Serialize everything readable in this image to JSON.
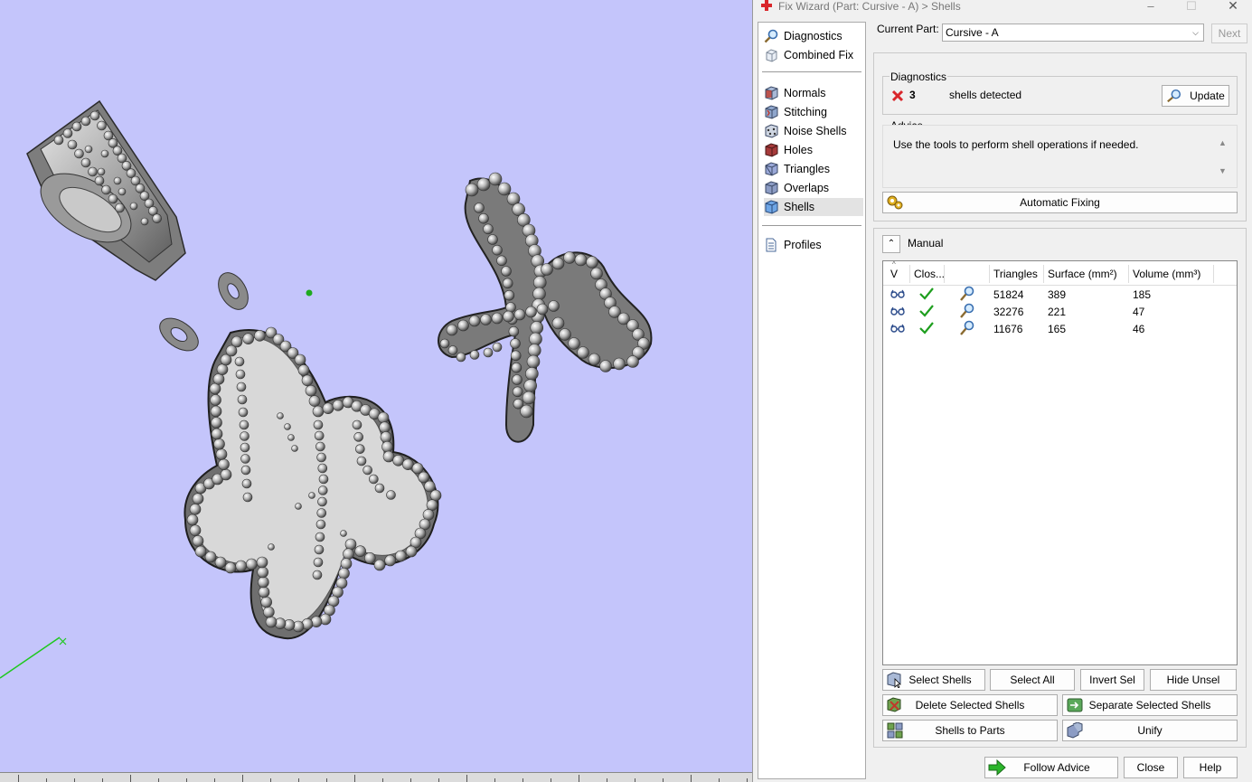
{
  "window": {
    "title": "Fix Wizard (Part: Cursive - A) > Shells",
    "minimize": "–",
    "maximize": "☐",
    "close": "✕"
  },
  "nav": {
    "top_items": [
      {
        "label": "Diagnostics",
        "icon": "magnifier-icon"
      },
      {
        "label": "Combined Fix",
        "icon": "cube-icon"
      }
    ],
    "items": [
      {
        "label": "Normals",
        "icon": "normals-cube-icon"
      },
      {
        "label": "Stitching",
        "icon": "stitching-cube-icon"
      },
      {
        "label": "Noise Shells",
        "icon": "noise-shells-icon"
      },
      {
        "label": "Holes",
        "icon": "holes-cube-icon"
      },
      {
        "label": "Triangles",
        "icon": "triangles-cube-icon"
      },
      {
        "label": "Overlaps",
        "icon": "overlaps-cube-icon"
      },
      {
        "label": "Shells",
        "icon": "shells-cube-icon",
        "selected": true
      }
    ],
    "bottom_items": [
      {
        "label": "Profiles",
        "icon": "document-icon"
      }
    ]
  },
  "current_part": {
    "label": "Current Part:",
    "value": "Cursive - A",
    "next": "Next"
  },
  "diagnostics": {
    "title": "Diagnostics",
    "count": "3",
    "text": "shells detected",
    "update": "Update"
  },
  "advice": {
    "title": "Advice",
    "text": "Use the tools to perform shell operations if needed.",
    "auto_fix": "Automatic Fixing"
  },
  "manual": {
    "title": "Manual",
    "columns": [
      "V",
      "Clos...",
      "",
      "Triangles",
      "Surface (mm²)",
      "Volume (mm³)"
    ],
    "rows": [
      {
        "triangles": "51824",
        "surface": "389",
        "volume": "185"
      },
      {
        "triangles": "32276",
        "surface": "221",
        "volume": "47"
      },
      {
        "triangles": "11676",
        "surface": "165",
        "volume": "46"
      }
    ],
    "buttons": {
      "select_shells": "Select Shells",
      "select_all": "Select All",
      "invert_sel": "Invert Sel",
      "hide_unsel": "Hide Unsel",
      "delete_selected": "Delete Selected Shells",
      "separate_selected": "Separate Selected Shells",
      "shells_to_parts": "Shells to Parts",
      "unify": "Unify"
    }
  },
  "footer": {
    "follow_advice": "Follow Advice",
    "close": "Close",
    "help": "Help"
  },
  "colors": {
    "viewport_bg": "#c4c5fb",
    "dialog_bg": "#f0f0f0",
    "error_red": "#d9262b",
    "check_green": "#1e9e1e",
    "arrow_green": "#2bb52b"
  }
}
